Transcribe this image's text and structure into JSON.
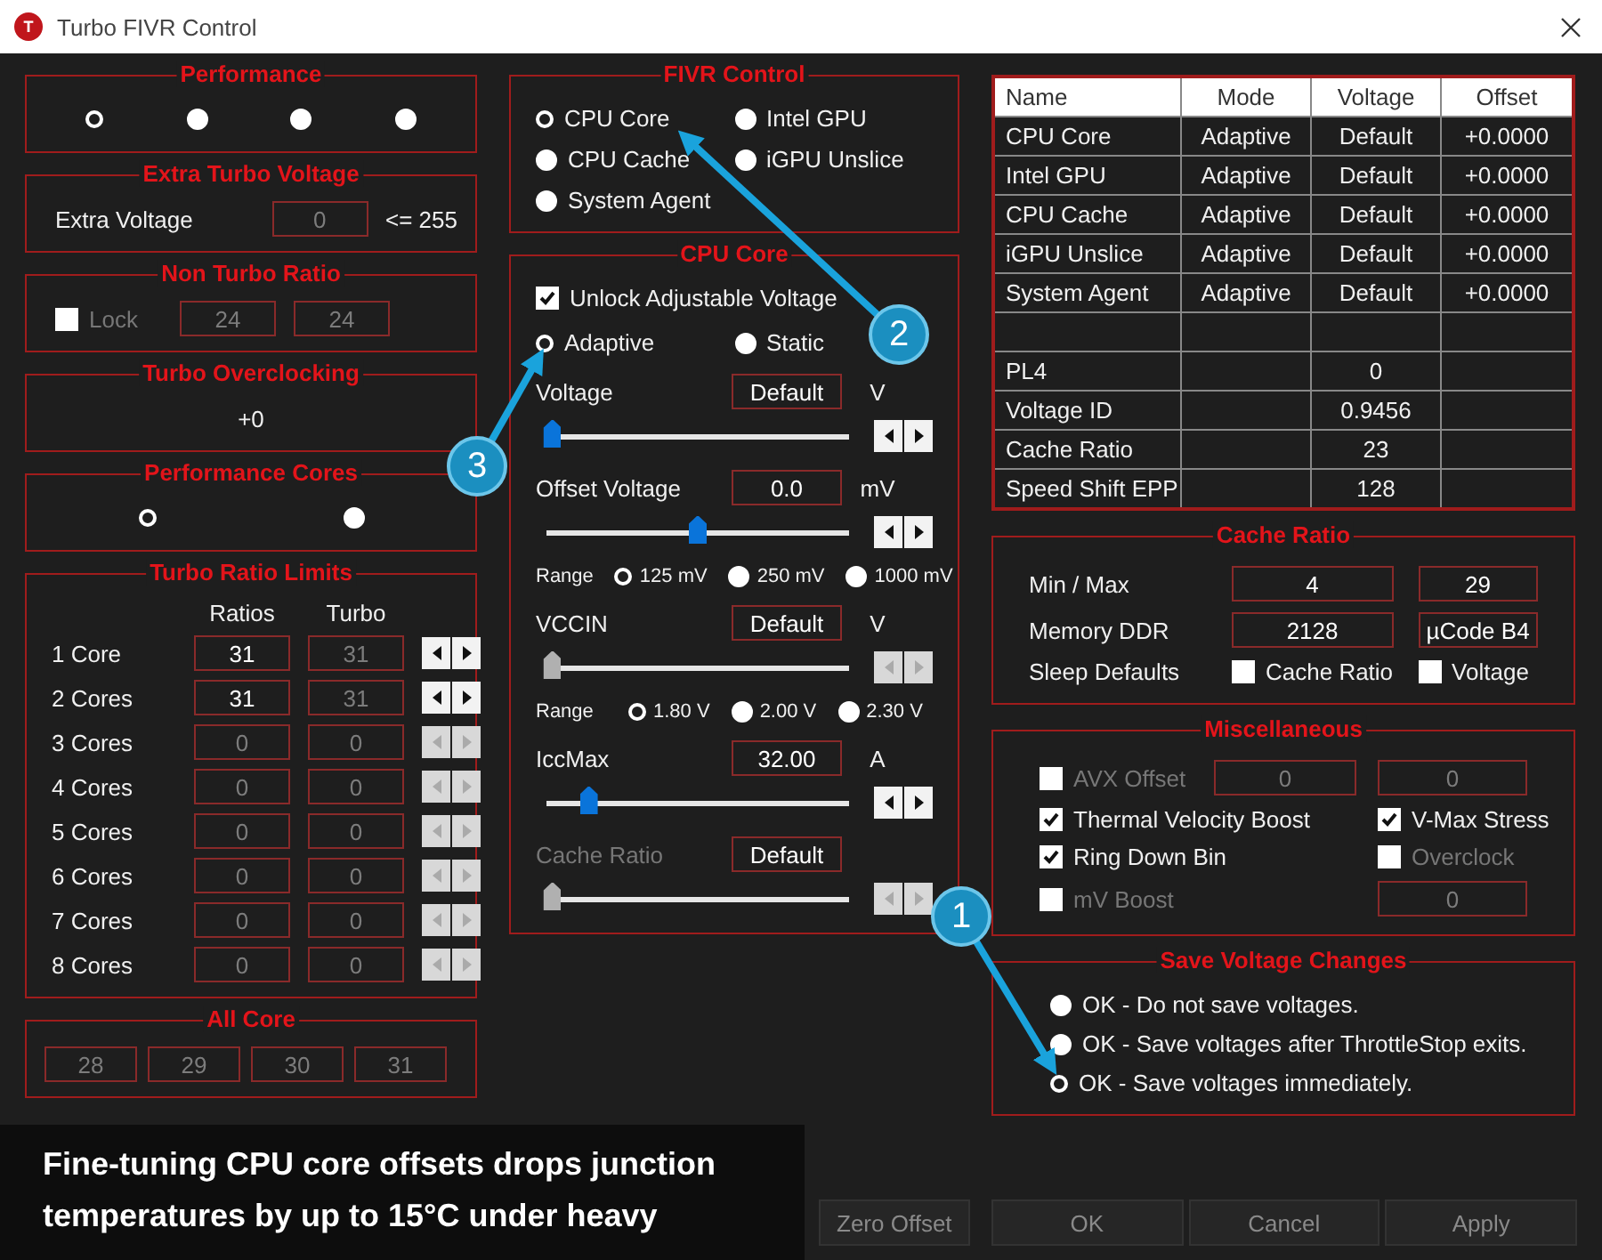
{
  "window": {
    "title": "Turbo FIVR Control",
    "icon_letter": "T"
  },
  "performance": {
    "title": "Performance",
    "options": [
      {
        "selected": true
      },
      {
        "selected": false
      },
      {
        "selected": false
      },
      {
        "selected": false
      }
    ]
  },
  "extra_turbo_voltage": {
    "title": "Extra Turbo Voltage",
    "label": "Extra Voltage",
    "value": "0",
    "limit": "<= 255"
  },
  "non_turbo_ratio": {
    "title": "Non Turbo Ratio",
    "lock": {
      "label": "Lock",
      "checked": false,
      "disabled": true
    },
    "values": [
      "24",
      "24"
    ]
  },
  "turbo_overclocking": {
    "title": "Turbo Overclocking",
    "value": "+0"
  },
  "performance_cores": {
    "title": "Performance Cores",
    "options": [
      {
        "selected": true
      },
      {
        "selected": false
      }
    ]
  },
  "turbo_ratio_limits": {
    "title": "Turbo Ratio Limits",
    "columns": [
      "Ratios",
      "Turbo"
    ],
    "rows": [
      {
        "label": "1 Core",
        "ratio": "31",
        "turbo": "31",
        "enabled": true
      },
      {
        "label": "2 Cores",
        "ratio": "31",
        "turbo": "31",
        "enabled": true
      },
      {
        "label": "3 Cores",
        "ratio": "0",
        "turbo": "0",
        "enabled": false
      },
      {
        "label": "4 Cores",
        "ratio": "0",
        "turbo": "0",
        "enabled": false
      },
      {
        "label": "5 Cores",
        "ratio": "0",
        "turbo": "0",
        "enabled": false
      },
      {
        "label": "6 Cores",
        "ratio": "0",
        "turbo": "0",
        "enabled": false
      },
      {
        "label": "7 Cores",
        "ratio": "0",
        "turbo": "0",
        "enabled": false
      },
      {
        "label": "8 Cores",
        "ratio": "0",
        "turbo": "0",
        "enabled": false
      }
    ]
  },
  "all_core": {
    "title": "All Core",
    "values": [
      "28",
      "29",
      "30",
      "31"
    ]
  },
  "fivr_control": {
    "title": "FIVR Control",
    "options": [
      {
        "label": "CPU Core",
        "selected": true
      },
      {
        "label": "Intel GPU",
        "selected": false
      },
      {
        "label": "CPU Cache",
        "selected": false
      },
      {
        "label": "iGPU Unslice",
        "selected": false
      },
      {
        "label": "System Agent",
        "selected": false
      }
    ]
  },
  "cpu_core": {
    "title": "CPU Core",
    "unlock": {
      "label": "Unlock Adjustable Voltage",
      "checked": true
    },
    "modes": [
      {
        "label": "Adaptive",
        "selected": true
      },
      {
        "label": "Static",
        "selected": false
      }
    ],
    "controls": [
      {
        "kind": "slider",
        "label": "Voltage",
        "value": "Default",
        "unit": "V",
        "level": 0.02,
        "disabled": false,
        "slider_disabled": false
      },
      {
        "kind": "slider",
        "label": "Offset Voltage",
        "value": "0.0",
        "unit": "mV",
        "level": 0.5,
        "disabled": false,
        "slider_disabled": false
      },
      {
        "kind": "range",
        "label": "Range",
        "options": [
          {
            "label": "125 mV",
            "selected": true
          },
          {
            "label": "250 mV",
            "selected": false
          },
          {
            "label": "1000 mV",
            "selected": false
          }
        ]
      },
      {
        "kind": "slider",
        "label": "VCCIN",
        "value": "Default",
        "unit": "V",
        "level": 0.02,
        "disabled": false,
        "slider_disabled": true
      },
      {
        "kind": "range",
        "label": "Range",
        "options": [
          {
            "label": "1.80 V",
            "selected": true
          },
          {
            "label": "2.00 V",
            "selected": false
          },
          {
            "label": "2.30 V",
            "selected": false
          }
        ]
      },
      {
        "kind": "slider",
        "label": "IccMax",
        "value": "32.00",
        "unit": "A",
        "level": 0.14,
        "disabled": false,
        "slider_disabled": false
      },
      {
        "kind": "slider",
        "label": "Cache Ratio",
        "value": "Default",
        "level": 0.02,
        "disabled": true,
        "slider_disabled": true
      }
    ]
  },
  "table": {
    "columns": [
      "Name",
      "Mode",
      "Voltage",
      "Offset"
    ],
    "rows": [
      {
        "kind": "data",
        "name": "CPU Core",
        "mode": "Adaptive",
        "voltage": "Default",
        "offset": "+0.0000"
      },
      {
        "kind": "data",
        "name": "Intel GPU",
        "mode": "Adaptive",
        "voltage": "Default",
        "offset": "+0.0000"
      },
      {
        "kind": "data",
        "name": "CPU Cache",
        "mode": "Adaptive",
        "voltage": "Default",
        "offset": "+0.0000"
      },
      {
        "kind": "data",
        "name": "iGPU Unslice",
        "mode": "Adaptive",
        "voltage": "Default",
        "offset": "+0.0000"
      },
      {
        "kind": "data",
        "name": "System Agent",
        "mode": "Adaptive",
        "voltage": "Default",
        "offset": "+0.0000"
      },
      {
        "kind": "spacer"
      },
      {
        "kind": "data",
        "name": "PL4",
        "voltage": "0"
      },
      {
        "kind": "data",
        "name": "Voltage ID",
        "voltage": "0.9456"
      },
      {
        "kind": "data",
        "name": "Cache Ratio",
        "voltage": "23"
      },
      {
        "kind": "data",
        "name": "Speed Shift EPP",
        "voltage": "128"
      }
    ]
  },
  "cache_ratio": {
    "title": "Cache Ratio",
    "rows": [
      {
        "label": "Min / Max",
        "values": [
          "4",
          "29"
        ]
      },
      {
        "label": "Memory DDR",
        "values": [
          "2128",
          "µCode B4"
        ]
      }
    ],
    "sleep_defaults": {
      "label": "Sleep Defaults",
      "checks": [
        {
          "label": "Cache Ratio",
          "checked": false
        },
        {
          "label": "Voltage",
          "checked": false
        }
      ]
    }
  },
  "miscellaneous": {
    "title": "Miscellaneous",
    "rows": [
      [
        {
          "kind": "checkbox",
          "label": "AVX Offset",
          "checked": false,
          "disabled": true
        },
        {
          "kind": "field",
          "value": "0",
          "disabled": true
        },
        {
          "kind": "field",
          "value": "0",
          "disabled": true
        }
      ],
      [
        {
          "kind": "checkbox",
          "label": "Thermal Velocity Boost",
          "checked": true,
          "disabled": false
        },
        {
          "kind": "blank"
        },
        {
          "kind": "checkbox",
          "label": "V-Max Stress",
          "checked": true,
          "disabled": false
        }
      ],
      [
        {
          "kind": "checkbox",
          "label": "Ring Down Bin",
          "checked": true,
          "disabled": false
        },
        {
          "kind": "blank"
        },
        {
          "kind": "checkbox",
          "label": "Overclock",
          "checked": false,
          "disabled": true
        }
      ],
      [
        {
          "kind": "checkbox",
          "label": "mV Boost",
          "checked": false,
          "disabled": true
        },
        {
          "kind": "blank"
        },
        {
          "kind": "field",
          "value": "0",
          "disabled": true
        }
      ]
    ]
  },
  "save_voltage_changes": {
    "title": "Save Voltage Changes",
    "options": [
      {
        "label": "OK - Do not save voltages.",
        "selected": false
      },
      {
        "label": "OK - Save voltages after ThrottleStop exits.",
        "selected": false
      },
      {
        "label": "OK - Save voltages immediately.",
        "selected": true
      }
    ]
  },
  "buttons": [
    "Zero Offset",
    "OK",
    "Cancel",
    "Apply"
  ],
  "callouts": [
    {
      "number": "1"
    },
    {
      "number": "2"
    },
    {
      "number": "3"
    }
  ],
  "caption": "Fine-tuning CPU core offsets drops junction temperatures by up to 15°C under heavy"
}
